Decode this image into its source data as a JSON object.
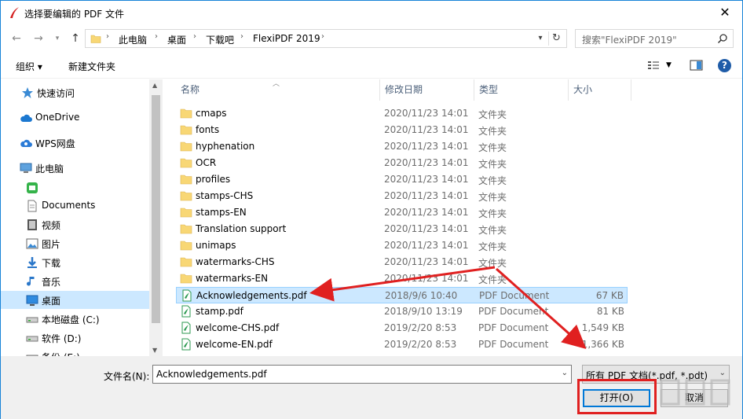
{
  "window": {
    "title": "选择要编辑的 PDF 文件",
    "close_label": "✕"
  },
  "address_bar": {
    "breadcrumbs": [
      "此电脑",
      "桌面",
      "下载吧",
      "FlexiPDF 2019"
    ],
    "search_placeholder": "搜索\"FlexiPDF 2019\""
  },
  "toolbar": {
    "organize_label": "组织 ▾",
    "new_folder_label": "新建文件夹"
  },
  "sidebar": {
    "items": [
      {
        "label": "快速访问",
        "icon": "star-icon"
      },
      {
        "label": "OneDrive",
        "icon": "cloud-icon"
      },
      {
        "label": "WPS网盘",
        "icon": "wps-cloud-icon"
      },
      {
        "label": "此电脑",
        "icon": "computer-icon"
      },
      {
        "label": "",
        "icon": "green-app-icon"
      },
      {
        "label": "Documents",
        "icon": "document-icon"
      },
      {
        "label": "视频",
        "icon": "video-icon"
      },
      {
        "label": "图片",
        "icon": "picture-icon"
      },
      {
        "label": "下载",
        "icon": "download-icon"
      },
      {
        "label": "音乐",
        "icon": "music-icon"
      },
      {
        "label": "桌面",
        "icon": "desktop-icon"
      },
      {
        "label": "本地磁盘 (C:)",
        "icon": "drive-icon"
      },
      {
        "label": "软件 (D:)",
        "icon": "drive-icon"
      },
      {
        "label": "备份 (E:)",
        "icon": "drive-icon"
      }
    ]
  },
  "columns": {
    "name": "名称",
    "date": "修改日期",
    "type": "类型",
    "size": "大小"
  },
  "files": [
    {
      "name": "cmaps",
      "date": "2020/11/23 14:01",
      "type": "文件夹",
      "size": "",
      "kind": "folder"
    },
    {
      "name": "fonts",
      "date": "2020/11/23 14:01",
      "type": "文件夹",
      "size": "",
      "kind": "folder"
    },
    {
      "name": "hyphenation",
      "date": "2020/11/23 14:01",
      "type": "文件夹",
      "size": "",
      "kind": "folder"
    },
    {
      "name": "OCR",
      "date": "2020/11/23 14:01",
      "type": "文件夹",
      "size": "",
      "kind": "folder"
    },
    {
      "name": "profiles",
      "date": "2020/11/23 14:01",
      "type": "文件夹",
      "size": "",
      "kind": "folder"
    },
    {
      "name": "stamps-CHS",
      "date": "2020/11/23 14:01",
      "type": "文件夹",
      "size": "",
      "kind": "folder"
    },
    {
      "name": "stamps-EN",
      "date": "2020/11/23 14:01",
      "type": "文件夹",
      "size": "",
      "kind": "folder"
    },
    {
      "name": "Translation support",
      "date": "2020/11/23 14:01",
      "type": "文件夹",
      "size": "",
      "kind": "folder"
    },
    {
      "name": "unimaps",
      "date": "2020/11/23 14:01",
      "type": "文件夹",
      "size": "",
      "kind": "folder"
    },
    {
      "name": "watermarks-CHS",
      "date": "2020/11/23 14:01",
      "type": "文件夹",
      "size": "",
      "kind": "folder"
    },
    {
      "name": "watermarks-EN",
      "date": "2020/11/23 14:01",
      "type": "文件夹",
      "size": "",
      "kind": "folder"
    },
    {
      "name": "Acknowledgements.pdf",
      "date": "2018/9/6 10:40",
      "type": "PDF Document",
      "size": "67 KB",
      "kind": "pdf"
    },
    {
      "name": "stamp.pdf",
      "date": "2018/9/10 13:19",
      "type": "PDF Document",
      "size": "81 KB",
      "kind": "pdf"
    },
    {
      "name": "welcome-CHS.pdf",
      "date": "2019/2/20 8:53",
      "type": "PDF Document",
      "size": "1,549 KB",
      "kind": "pdf"
    },
    {
      "name": "welcome-EN.pdf",
      "date": "2019/2/20 8:53",
      "type": "PDF Document",
      "size": "1,366 KB",
      "kind": "pdf"
    }
  ],
  "selected_file_index": 11,
  "selected_sidebar_index": 10,
  "bottom": {
    "filename_label": "文件名(N):",
    "filename_value": "Acknowledgements.pdf",
    "filter_value": "所有 PDF 文档(*.pdf, *.pdt)",
    "open_label": "打开(O)",
    "cancel_label": "取消"
  },
  "colors": {
    "accent": "#0078d7",
    "selection": "#cce8ff",
    "annotation_red": "#e02020",
    "folder": "#f8d775"
  }
}
